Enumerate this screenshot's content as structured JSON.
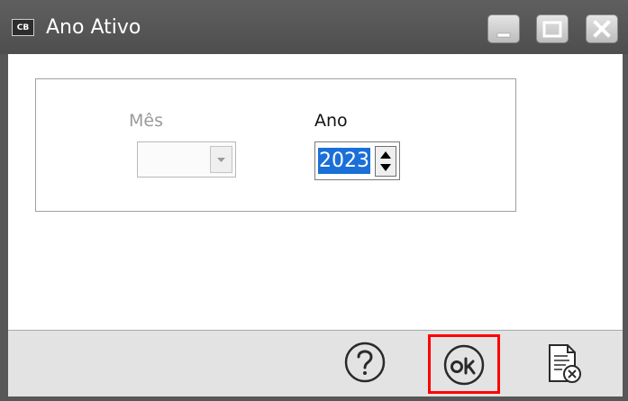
{
  "window": {
    "app_icon_text": "CB",
    "title": "Ano Ativo"
  },
  "form": {
    "mes_label": "Mês",
    "mes_value": "",
    "ano_label": "Ano",
    "ano_value": "2023"
  },
  "toolbar": {
    "help_icon": "question-circle-icon",
    "ok_icon": "ok-circle-icon",
    "cancel_icon": "document-cancel-icon"
  },
  "colors": {
    "titlebar": "#575757",
    "selection": "#1a6fd8",
    "highlight_border": "#ff0000"
  }
}
